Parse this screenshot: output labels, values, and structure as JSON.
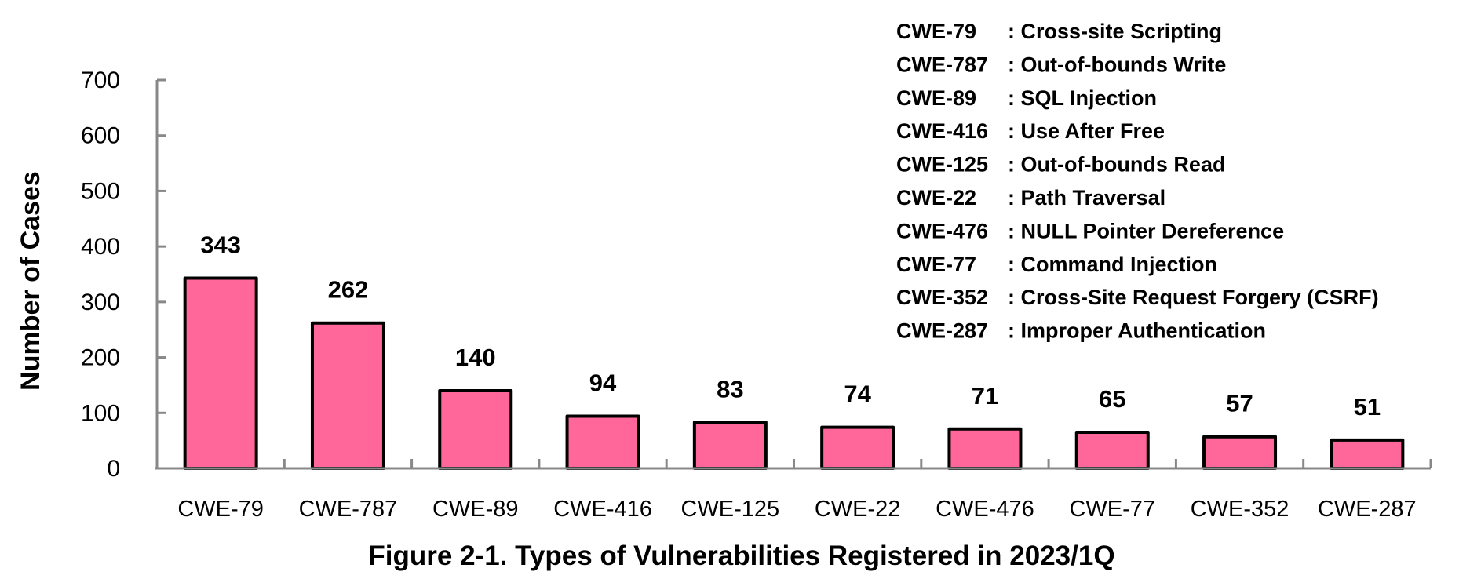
{
  "chart_data": {
    "type": "bar",
    "title": "Figure 2-1. Types of Vulnerabilities Registered in 2023/1Q",
    "xlabel": "",
    "ylabel": "Number of Cases",
    "ylim": [
      0,
      700
    ],
    "yticks": [
      0,
      100,
      200,
      300,
      400,
      500,
      600,
      700
    ],
    "grid": false,
    "categories": [
      "CWE-79",
      "CWE-787",
      "CWE-89",
      "CWE-416",
      "CWE-125",
      "CWE-22",
      "CWE-476",
      "CWE-77",
      "CWE-352",
      "CWE-287"
    ],
    "values": [
      343,
      262,
      140,
      94,
      83,
      74,
      71,
      65,
      57,
      51
    ],
    "data_labels": [
      "343",
      "262",
      "140",
      "94",
      "83",
      "74",
      "71",
      "65",
      "57",
      "51"
    ],
    "bar_color": "#FF6699",
    "bar_edge_color": "#000000",
    "axis_color": "#888888",
    "legend_placement": "top-right",
    "legend": [
      {
        "code": "CWE-79",
        "desc": ": Cross-site Scripting"
      },
      {
        "code": "CWE-787",
        "desc": ": Out-of-bounds Write"
      },
      {
        "code": "CWE-89",
        "desc": ": SQL Injection"
      },
      {
        "code": "CWE-416",
        "desc": ": Use After Free"
      },
      {
        "code": "CWE-125",
        "desc": ": Out-of-bounds Read"
      },
      {
        "code": "CWE-22",
        "desc": ": Path Traversal"
      },
      {
        "code": "CWE-476",
        "desc": ": NULL Pointer Dereference"
      },
      {
        "code": "CWE-77",
        "desc": ": Command Injection"
      },
      {
        "code": "CWE-352",
        "desc": ": Cross-Site Request Forgery (CSRF)"
      },
      {
        "code": "CWE-287",
        "desc": ": Improper Authentication"
      }
    ]
  }
}
